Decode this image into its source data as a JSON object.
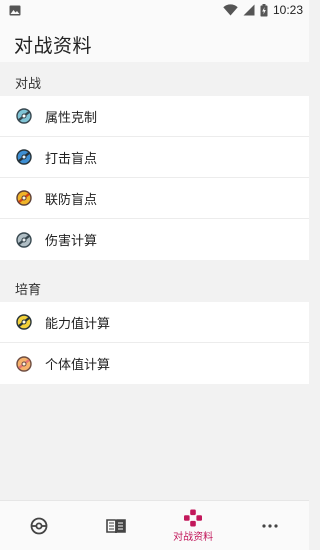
{
  "status_bar": {
    "time": "10:23"
  },
  "header": {
    "title": "对战资料"
  },
  "sections": [
    {
      "title": "对战",
      "items": [
        {
          "label": "属性克制",
          "icon": "pokeball-teal-icon"
        },
        {
          "label": "打击盲点",
          "icon": "pokeball-blue-icon"
        },
        {
          "label": "联防盲点",
          "icon": "pokeball-orange-icon"
        },
        {
          "label": "伤害计算",
          "icon": "pokeball-gray-icon"
        }
      ]
    },
    {
      "title": "培育",
      "items": [
        {
          "label": "能力值计算",
          "icon": "pokeball-yellow-icon"
        },
        {
          "label": "个体值计算",
          "icon": "pokeball-peach-icon"
        }
      ]
    }
  ],
  "bottom_nav": {
    "items": [
      {
        "icon": "pokeball-icon"
      },
      {
        "icon": "book-icon"
      },
      {
        "icon": "gamepad-icon",
        "label": "对战资料",
        "active": true
      },
      {
        "icon": "more-icon"
      }
    ]
  },
  "colors": {
    "accent": "#c2185b",
    "background": "#f2f2f2"
  }
}
